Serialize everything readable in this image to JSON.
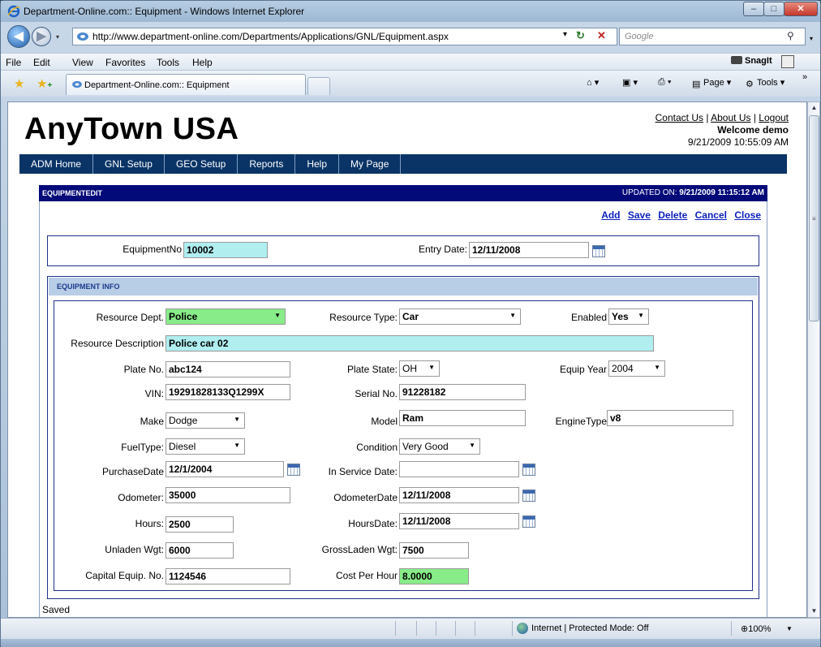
{
  "window": {
    "title": "Department-Online.com:: Equipment - Windows Internet Explorer",
    "min": "–",
    "max": "□",
    "close": "✕"
  },
  "nav": {
    "back": "◀",
    "forward": "▶",
    "dropdown": "▾",
    "url": "http://www.department-online.com/Departments/Applications/GNL/Equipment.aspx",
    "search_placeholder": "Google",
    "refresh": "↻",
    "stop": "✕",
    "search_icon": "⚲"
  },
  "menu": [
    {
      "label": "File"
    },
    {
      "label": "Edit"
    },
    {
      "label": "View"
    },
    {
      "label": "Favorites"
    },
    {
      "label": "Tools"
    },
    {
      "label": "Help"
    }
  ],
  "snagit": "SnagIt",
  "tab": {
    "label": "Department-Online.com:: Equipment"
  },
  "commands": {
    "page": "Page",
    "tools": "Tools",
    "more": "»"
  },
  "status": {
    "zone": "Internet | Protected Mode: Off",
    "zoom": "100%"
  },
  "page": {
    "logo": "AnyTown USA",
    "links": {
      "contact": "Contact Us",
      "about": "About Us",
      "logout": "Logout",
      "sep": "|"
    },
    "welcome": "Welcome demo",
    "datetime": "9/21/2009 10:55:09 AM",
    "nav": [
      "ADM Home",
      "GNL Setup",
      "GEO Setup",
      "Reports",
      "Help",
      "My Page"
    ],
    "edit_title": "EQUIPMENTEDIT",
    "updated_label": "UPDATED ON:",
    "updated_value": "9/21/2009 11:15:12 AM",
    "actions": [
      "Add",
      "Save",
      "Delete",
      "Cancel",
      "Close"
    ],
    "section_title": "EQUIPMENT INFO",
    "saved": "Saved"
  },
  "form": {
    "equipment_no": {
      "label": "EquipmentNo",
      "value": "10002"
    },
    "entry_date": {
      "label": "Entry Date:",
      "value": "12/11/2008"
    },
    "resource_dept": {
      "label": "Resource Dept.",
      "value": "Police"
    },
    "resource_type": {
      "label": "Resource Type:",
      "value": "Car"
    },
    "enabled": {
      "label": "Enabled",
      "value": "Yes"
    },
    "resource_desc": {
      "label": "Resource Description",
      "value": "Police car 02"
    },
    "plate_no": {
      "label": "Plate No.",
      "value": "abc124"
    },
    "plate_state": {
      "label": "Plate State:",
      "value": "OH"
    },
    "equip_year": {
      "label": "Equip Year",
      "value": "2004"
    },
    "vin": {
      "label": "VIN:",
      "value": "19291828133Q1299X"
    },
    "serial_no": {
      "label": "Serial No.",
      "value": "91228182"
    },
    "make": {
      "label": "Make",
      "value": "Dodge"
    },
    "model": {
      "label": "Model",
      "value": "Ram"
    },
    "engine_type": {
      "label": "EngineType",
      "value": "v8"
    },
    "fuel_type": {
      "label": "FuelType:",
      "value": "Diesel"
    },
    "condition": {
      "label": "Condition",
      "value": "Very Good"
    },
    "purchase_date": {
      "label": "PurchaseDate",
      "value": "12/1/2004"
    },
    "in_service_date": {
      "label": "In Service Date:",
      "value": ""
    },
    "odometer": {
      "label": "Odometer:",
      "value": "35000"
    },
    "odometer_date": {
      "label": "OdometerDate",
      "value": "12/11/2008"
    },
    "hours": {
      "label": "Hours:",
      "value": "2500"
    },
    "hours_date": {
      "label": "HoursDate:",
      "value": "12/11/2008"
    },
    "unladen_wgt": {
      "label": "Unladen Wgt:",
      "value": "6000"
    },
    "grossladen_wgt": {
      "label": "GrossLaden Wgt:",
      "value": "7500"
    },
    "capital_equip_no": {
      "label": "Capital Equip. No.",
      "value": "1124546"
    },
    "cost_per_hour": {
      "label": "Cost Per Hour",
      "value": "8.0000"
    }
  }
}
